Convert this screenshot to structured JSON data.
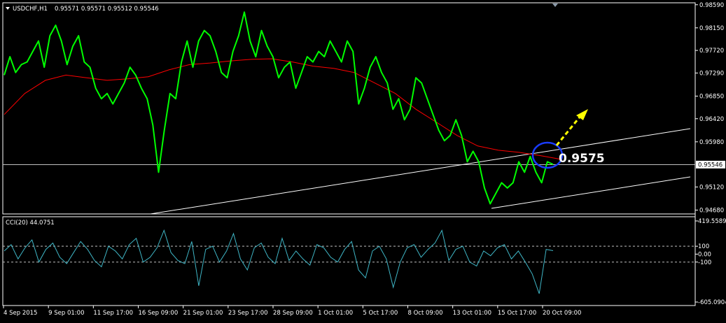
{
  "window": {
    "symbol_label": "USDCHF,H1",
    "ohlc_values": "0.95571 0.95571 0.95512 0.95546",
    "indicator_label": "CCI(20) 44.0751"
  },
  "annotation": {
    "price_callout": "0.9575"
  },
  "colors": {
    "background": "#000000",
    "price": "#00ff00",
    "moving_average": "#ff0000",
    "cci": "#3fb6c6",
    "trendline": "#ffffff",
    "circle": "#0000ff",
    "arrow": "#ffff00"
  },
  "chart_data": [
    {
      "type": "line",
      "title": "USDCHF,H1",
      "x_tick_labels": [
        "4 Sep 2015",
        "9 Sep 01:00",
        "11 Sep 17:00",
        "16 Sep 09:00",
        "21 Sep 01:00",
        "23 Sep 17:00",
        "28 Sep 09:00",
        "1 Oct 01:00",
        "5 Oct 17:00",
        "8 Oct 09:00",
        "13 Oct 01:00",
        "15 Oct 17:00",
        "20 Oct 09:00"
      ],
      "y_tick_labels": [
        "0.98590",
        "0.98150",
        "0.97720",
        "0.97290",
        "0.96850",
        "0.96420",
        "0.95980",
        "0.95546",
        "0.95120",
        "0.94680"
      ],
      "ylim": [
        0.9466,
        0.986
      ],
      "current_price": 0.95546,
      "series": [
        {
          "name": "USDCHF",
          "values": [
            0.9725,
            0.976,
            0.973,
            0.9745,
            0.975,
            0.977,
            0.979,
            0.974,
            0.98,
            0.982,
            0.979,
            0.9745,
            0.978,
            0.98,
            0.975,
            0.974,
            0.97,
            0.968,
            0.969,
            0.967,
            0.969,
            0.971,
            0.974,
            0.9725,
            0.97,
            0.968,
            0.963,
            0.954,
            0.962,
            0.969,
            0.968,
            0.975,
            0.979,
            0.974,
            0.979,
            0.981,
            0.98,
            0.977,
            0.973,
            0.972,
            0.977,
            0.98,
            0.9845,
            0.979,
            0.976,
            0.981,
            0.978,
            0.976,
            0.972,
            0.974,
            0.975,
            0.97,
            0.973,
            0.976,
            0.975,
            0.977,
            0.976,
            0.979,
            0.977,
            0.975,
            0.979,
            0.977,
            0.967,
            0.97,
            0.974,
            0.976,
            0.973,
            0.971,
            0.966,
            0.968,
            0.964,
            0.966,
            0.972,
            0.971,
            0.968,
            0.965,
            0.962,
            0.96,
            0.961,
            0.964,
            0.961,
            0.956,
            0.958,
            0.956,
            0.951,
            0.948,
            0.95,
            0.952,
            0.951,
            0.952,
            0.956,
            0.954,
            0.957,
            0.954,
            0.952,
            0.956,
            0.9555
          ]
        },
        {
          "name": "MA",
          "values": [
            0.965,
            0.969,
            0.9715,
            0.9725,
            0.972,
            0.9715,
            0.9718,
            0.9722,
            0.9735,
            0.9745,
            0.9748,
            0.9752,
            0.9755,
            0.9756,
            0.975,
            0.9742,
            0.9738,
            0.973,
            0.971,
            0.969,
            0.966,
            0.9635,
            0.961,
            0.959,
            0.9582,
            0.9578,
            0.9572,
            0.9565
          ]
        }
      ]
    },
    {
      "type": "line",
      "title": "CCI(20) 44.0751",
      "y_tick_labels": [
        "419.5589",
        "100",
        "0.00",
        "-100",
        "-605.0904"
      ],
      "ylim": [
        -605.0904,
        419.5589
      ],
      "levels": [
        100,
        -100
      ],
      "series": [
        {
          "name": "CCI(20)",
          "values": [
            40,
            120,
            -60,
            80,
            180,
            -100,
            60,
            140,
            -40,
            -120,
            20,
            160,
            60,
            -80,
            -160,
            100,
            40,
            -60,
            120,
            200,
            -100,
            -40,
            80,
            300,
            20,
            -80,
            -120,
            160,
            -400,
            60,
            100,
            -100,
            40,
            260,
            -60,
            -200,
            80,
            140,
            -40,
            -120,
            200,
            -80,
            40,
            -60,
            -140,
            120,
            80,
            -40,
            -100,
            60,
            160,
            -200,
            -300,
            40,
            100,
            -60,
            -420,
            -100,
            80,
            120,
            -40,
            60,
            140,
            300,
            -80,
            60,
            100,
            -100,
            -150,
            40,
            -20,
            80,
            120,
            -60,
            40,
            -100,
            -250,
            -500,
            60,
            44
          ]
        }
      ]
    }
  ]
}
